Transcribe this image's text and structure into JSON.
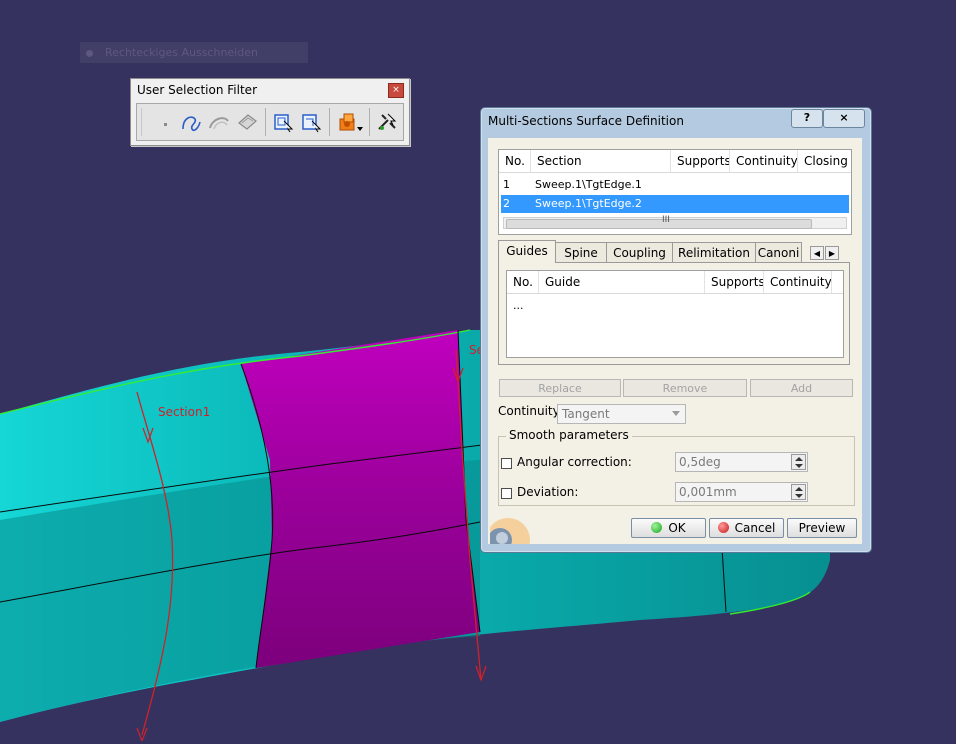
{
  "viewport": {
    "ghost_toolbar_label": "Rechteckiges Ausschneiden",
    "section1_label": "Section1",
    "section2_label": "Se"
  },
  "selection_filter": {
    "title": "User Selection Filter",
    "close_glyph": "×",
    "tools": [
      "point-filter-icon",
      "curve-filter-icon",
      "surface-filter-icon",
      "volume-filter-icon",
      "feature-element-filter-icon",
      "geometrical-element-filter-icon",
      "tool-dropdown-icon",
      "quick-select-icon"
    ]
  },
  "dialog": {
    "title": "Multi-Sections Surface Definition",
    "help_label": "?",
    "close_label": "×",
    "sections_table": {
      "columns": [
        "No.",
        "Section",
        "Supports",
        "Continuity",
        "Closing P"
      ],
      "rows": [
        {
          "no": "1",
          "section": "Sweep.1\\TgtEdge.1",
          "selected": false
        },
        {
          "no": "2",
          "section": "Sweep.1\\TgtEdge.2",
          "selected": true
        }
      ],
      "scroll_grip": "III"
    },
    "tabs": [
      "Guides",
      "Spine",
      "Coupling",
      "Relimitation",
      "Canoni"
    ],
    "active_tab": "Guides",
    "tab_scroll_left": "◀",
    "tab_scroll_right": "▶",
    "guides_table": {
      "columns": [
        "No.",
        "Guide",
        "Supports",
        "Continuity"
      ],
      "placeholder": "..."
    },
    "actions": {
      "replace": "Replace",
      "remove": "Remove",
      "add": "Add"
    },
    "continuity_label": "Continuity:",
    "continuity_value": "Tangent",
    "smooth": {
      "title": "Smooth parameters",
      "angular_label": "Angular correction:",
      "angular_value": "0,5deg",
      "angular_checked": false,
      "deviation_label": "Deviation:",
      "deviation_value": "0,001mm",
      "deviation_checked": false
    },
    "buttons": {
      "ok": "OK",
      "cancel": "Cancel",
      "preview": "Preview"
    }
  },
  "colors": {
    "background": "#36325f",
    "surface_cyan": "#0aa5a5",
    "surface_selected": "#a0009f",
    "edge_green": "#33ee33",
    "section_red": "#d0212a",
    "selection_blue": "#3399ff"
  }
}
